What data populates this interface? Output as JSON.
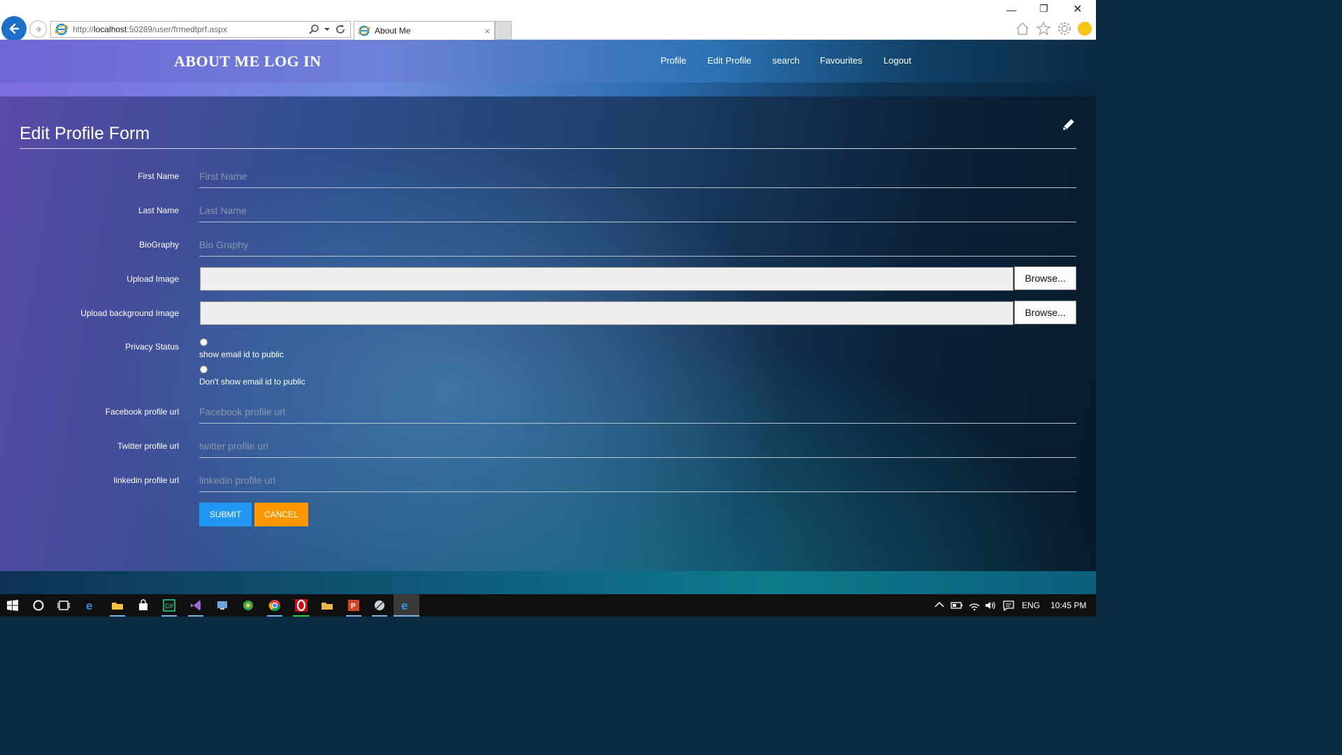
{
  "browser": {
    "url_prefix": "http://",
    "url_host": "localhost",
    "url_rest": ":50289/user/frmedtprf.aspx",
    "tab_title": "About Me",
    "tab_close": "×"
  },
  "navbar": {
    "brand": "ABOUT ME LOG IN",
    "links": [
      "Profile",
      "Edit Profile",
      "search",
      "Favourites",
      "Logout"
    ]
  },
  "form": {
    "title": "Edit Profile Form",
    "first_name": {
      "label": "First Name",
      "placeholder": "First Name"
    },
    "last_name": {
      "label": "Last Name",
      "placeholder": "Last Name"
    },
    "biography": {
      "label": "BioGraphy",
      "placeholder": "Bio Graphy"
    },
    "upload_image": {
      "label": "Upload Image",
      "button": "Browse..."
    },
    "upload_bg": {
      "label": "Upload background Image",
      "button": "Browse..."
    },
    "privacy": {
      "label": "Privacy Status",
      "options": [
        "show email id to public",
        "Don't show email id to public"
      ]
    },
    "facebook": {
      "label": "Facebook profile url",
      "placeholder": "Facebook profile url"
    },
    "twitter": {
      "label": "Twitter profile url",
      "placeholder": "twitter profile url"
    },
    "linkedin": {
      "label": "linkedin profile url",
      "placeholder": "linkedin profile url"
    },
    "submit": "SUBMIT",
    "cancel": "CANCEL"
  },
  "taskbar": {
    "lang": "ENG",
    "time": "10:45 PM"
  },
  "colors": {
    "submit": "#2196f3",
    "cancel": "#ff9800",
    "ie_back": "#1c70c9"
  }
}
